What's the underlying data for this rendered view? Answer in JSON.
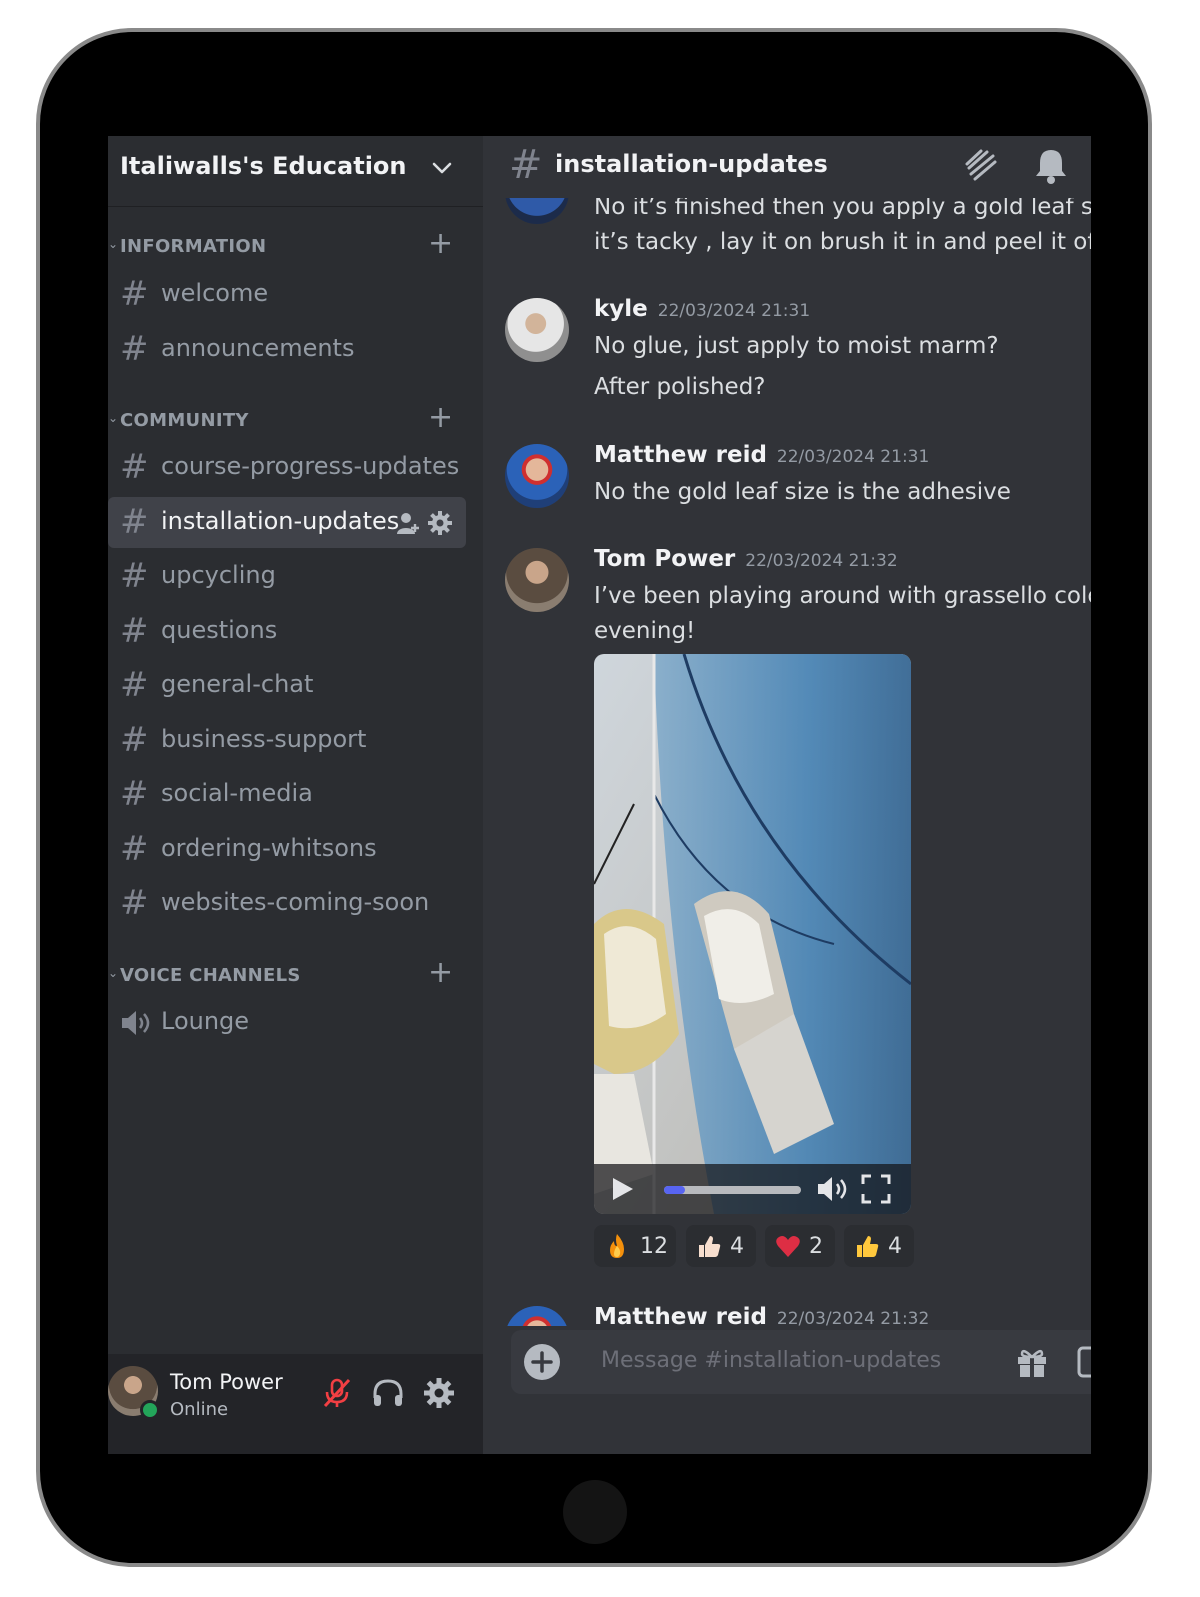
{
  "server": {
    "name": "Italiwalls's Education"
  },
  "categories": {
    "information": "INFORMATION",
    "community": "COMMUNITY",
    "voice": "VOICE CHANNELS"
  },
  "channels": {
    "welcome": "welcome",
    "announcements": "announcements",
    "course_progress": "course-progress-updates",
    "installation": "installation-updates",
    "upcycling": "upcycling",
    "questions": "questions",
    "general": "general-chat",
    "business": "business-support",
    "social": "social-media",
    "ordering": "ordering-whitsons",
    "websites": "websites-coming-soon",
    "lounge": "Lounge"
  },
  "user": {
    "name": "Tom Power",
    "status": "Online"
  },
  "header": {
    "channel": "installation-updates"
  },
  "messages": {
    "m0": {
      "line1": "No it’s finished then you apply a gold leaf size",
      "line2": "it’s tacky , lay it on brush it in and peel it off"
    },
    "m1": {
      "author": "kyle",
      "time": "22/03/2024 21:31",
      "line1": "No glue, just apply to moist marm?",
      "line2": "After polished?"
    },
    "m2": {
      "author": "Matthew reid",
      "time": "22/03/2024 21:31",
      "line1": "No the gold leaf size is the adhesive"
    },
    "m3": {
      "author": "Tom Power",
      "time": "22/03/2024 21:32",
      "line1": "I’ve been playing around with grassello colour this",
      "line2": "evening!",
      "video_progress": 0.15,
      "reactions": {
        "fire": "12",
        "thumbs_light": "4",
        "heart": "2",
        "thumbs_yellow": "4"
      }
    },
    "m4": {
      "author": "Matthew reid",
      "time": "22/03/2024 21:32"
    }
  },
  "composer": {
    "placeholder": "Message #installation-updates"
  },
  "colors": {
    "sidebar": "#2b2d31",
    "main": "#313338",
    "active": "#404249",
    "online": "#23a55a",
    "muted_red": "#f23f43",
    "progress": "#5865f2"
  }
}
